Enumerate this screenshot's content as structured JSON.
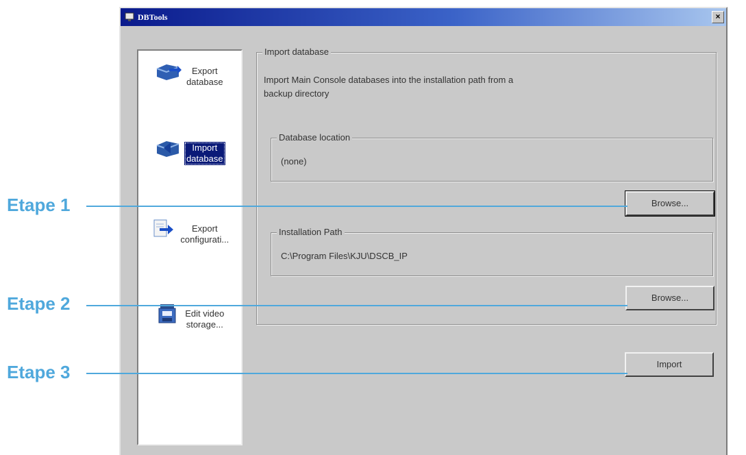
{
  "window": {
    "title": "DBTools",
    "close_glyph": "×"
  },
  "sidebar": {
    "items": [
      {
        "line1": "Export",
        "line2": "database",
        "icon": "database-export-icon",
        "selected": false
      },
      {
        "line1": "Import",
        "line2": "database",
        "icon": "database-import-icon",
        "selected": true
      },
      {
        "line1": "Export",
        "line2": "configurati...",
        "icon": "config-export-icon",
        "selected": false
      },
      {
        "line1": "Edit video",
        "line2": "storage...",
        "icon": "video-storage-icon",
        "selected": false
      }
    ]
  },
  "main": {
    "group_title": "Import database",
    "description_line1": "Import Main Console databases into the installation path from a",
    "description_line2": "backup directory",
    "db_location": {
      "label": "Database location",
      "value": "(none)",
      "browse_label": "Browse..."
    },
    "install_path": {
      "label": "Installation Path",
      "value": "C:\\Program Files\\KJU\\DSCB_IP",
      "browse_label": "Browse..."
    },
    "import_label": "Import"
  },
  "callouts": [
    {
      "label": "Etape 1"
    },
    {
      "label": "Etape 2"
    },
    {
      "label": "Etape 3"
    }
  ],
  "colors": {
    "accent": "#4fa8dc",
    "titlebar": "#0a1a8c",
    "window_bg": "#c9c9c9"
  }
}
